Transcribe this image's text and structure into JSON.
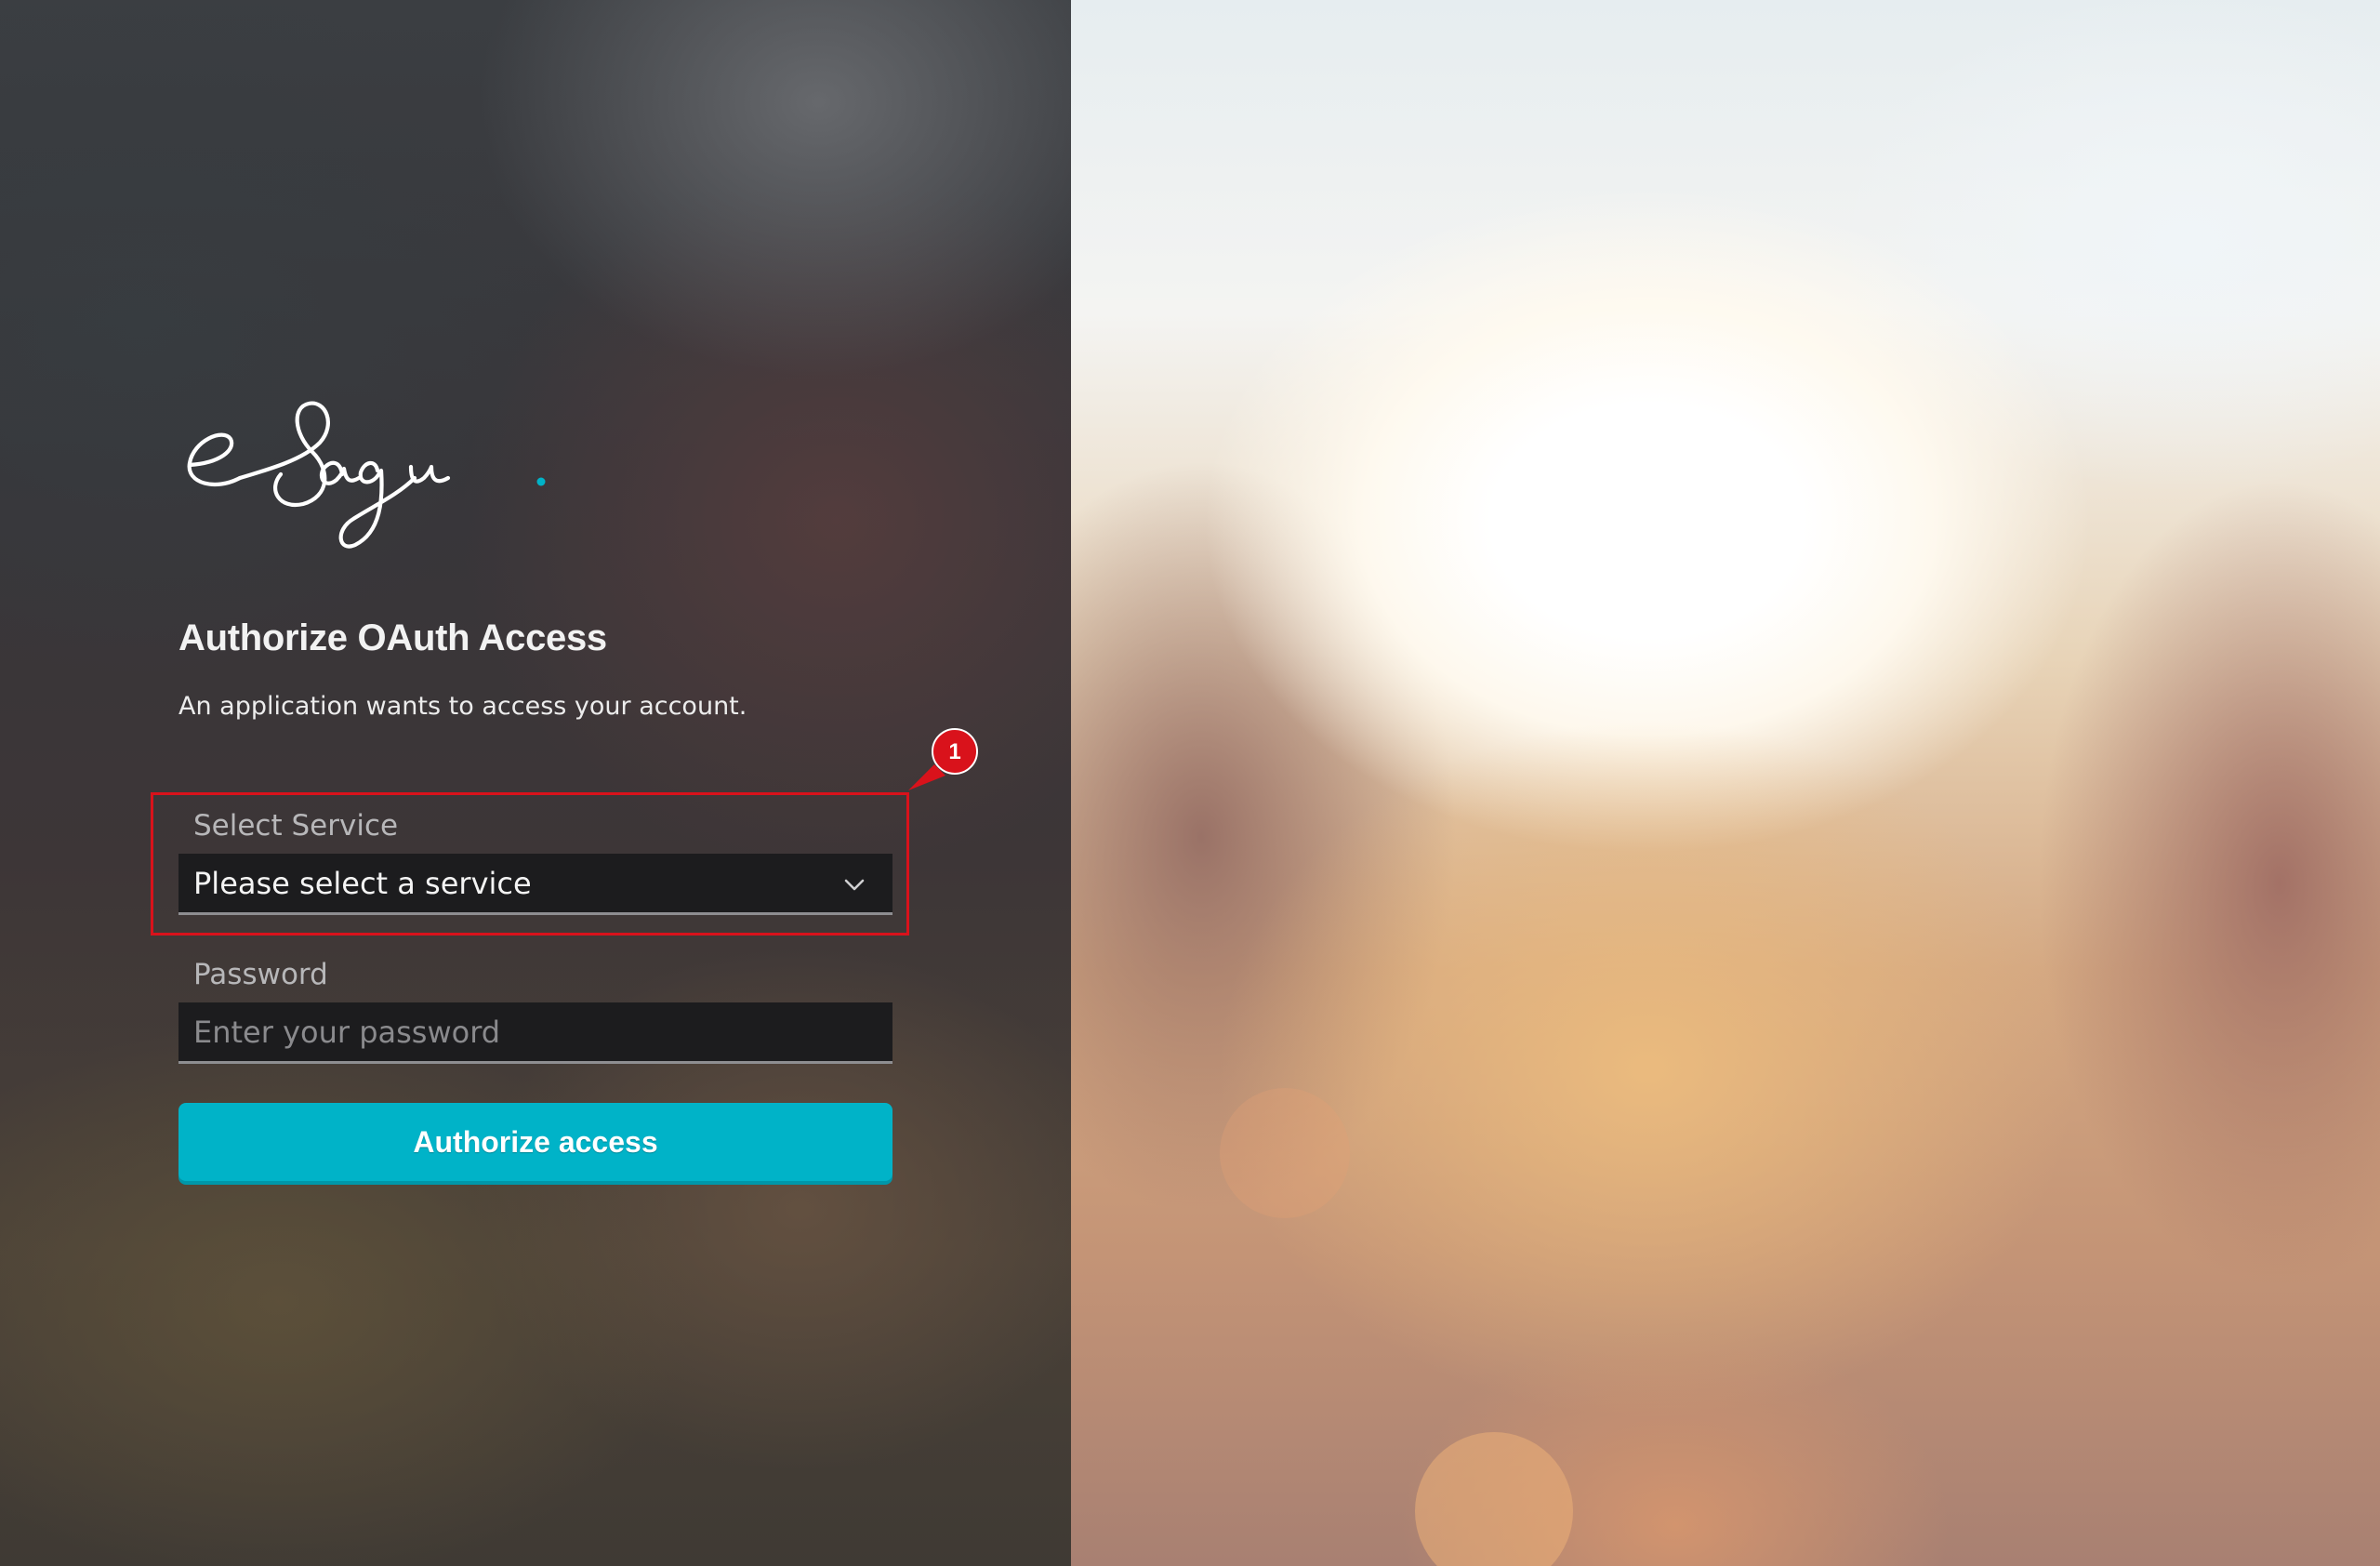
{
  "app": {
    "logo_text": "eSagu."
  },
  "auth": {
    "title": "Authorize OAuth Access",
    "subtitle": "An application wants to access your account."
  },
  "form": {
    "service_label": "Select Service",
    "service_selected": "Please select a service",
    "password_label": "Password",
    "password_placeholder": "Enter your password",
    "submit_label": "Authorize access"
  },
  "annotation": {
    "number": "1"
  },
  "colors": {
    "accent": "#00b3c8",
    "annotation": "#d9121b",
    "logo_dot": "#00b3c8"
  }
}
